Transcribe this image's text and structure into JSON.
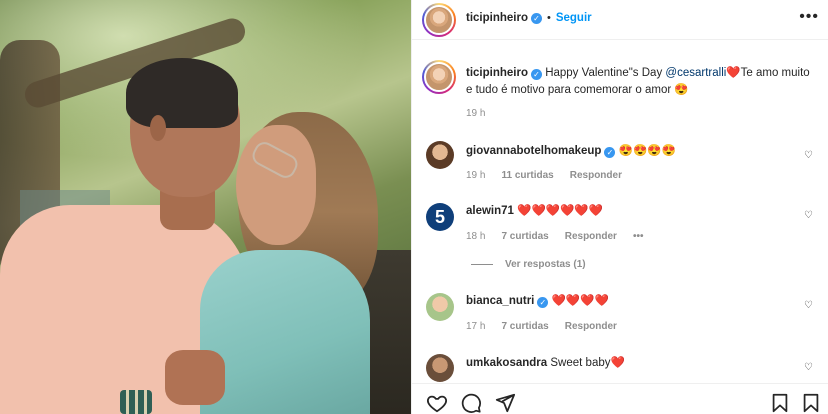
{
  "post": {
    "author": "ticipinheiro",
    "follow_label": "Seguir",
    "caption_text": "Happy Valentine\"s Day",
    "caption_mention": "@cesartralli",
    "caption_heart": "❤️",
    "caption_rest": "Te amo muito e tudo é motivo para comemorar o amor",
    "caption_emoji": "😍",
    "time": "19 h"
  },
  "comments": [
    {
      "username": "giovannabotelhomakeup",
      "verified": true,
      "text": "😍😍😍😍",
      "time": "19 h",
      "likes": "11 curtidas",
      "reply": "Responder"
    },
    {
      "username": "alewin71",
      "verified": false,
      "text": "❤️❤️❤️❤️❤️❤️",
      "time": "18 h",
      "likes": "7 curtidas",
      "reply": "Responder",
      "more": "•••",
      "view_replies": "Ver respostas (1)"
    },
    {
      "username": "bianca_nutri",
      "verified": true,
      "text": "❤️❤️❤️❤️",
      "time": "17 h",
      "likes": "7 curtidas",
      "reply": "Responder"
    },
    {
      "username": "umkakosandra",
      "verified": false,
      "text": "Sweet baby❤️"
    }
  ],
  "icons": {
    "more": "more-options-icon",
    "like": "heart-icon",
    "comment": "comment-icon",
    "share": "share-icon",
    "save": "bookmark-icon"
  },
  "colors": {
    "accent": "#0095f6",
    "verified": "#3897f0",
    "mention": "#00376b",
    "muted": "#8e8e8e"
  }
}
